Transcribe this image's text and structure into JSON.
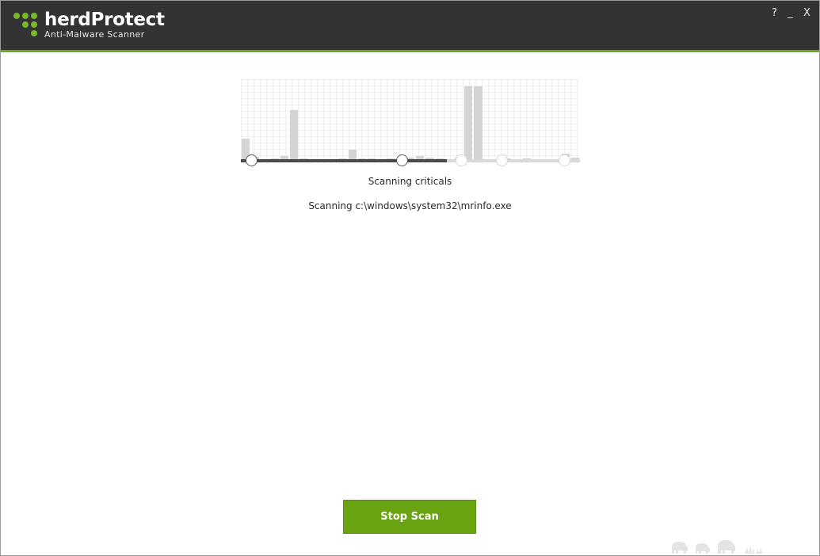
{
  "app": {
    "name": "herdProtect",
    "tagline": "Anti-Malware Scanner"
  },
  "window_controls": {
    "help": "?",
    "minimize": "_",
    "close": "X"
  },
  "progress": {
    "steps_total": 5,
    "steps_completed": 2,
    "histogram_levels": [
      0.3,
      0.06,
      0.02,
      0.04,
      0.07,
      0.68,
      0.04,
      0.03,
      0.03,
      0.03,
      0.04,
      0.16,
      0.04,
      0.04,
      0.03,
      0.04,
      0.03,
      0.05,
      0.07,
      0.05,
      0.04,
      0.03,
      0.05,
      1.0,
      1.0,
      0.02,
      0.03,
      0.04,
      0.03,
      0.04,
      0.02,
      0.03,
      0.02,
      0.1,
      0.05
    ]
  },
  "scan": {
    "phase": "Scanning criticals",
    "current_file": "Scanning c:\\windows\\system32\\mrinfo.exe"
  },
  "actions": {
    "stop_label": "Stop Scan"
  },
  "colors": {
    "accent": "#6aac12",
    "button": "#6aa312",
    "titlebar": "#333333"
  }
}
